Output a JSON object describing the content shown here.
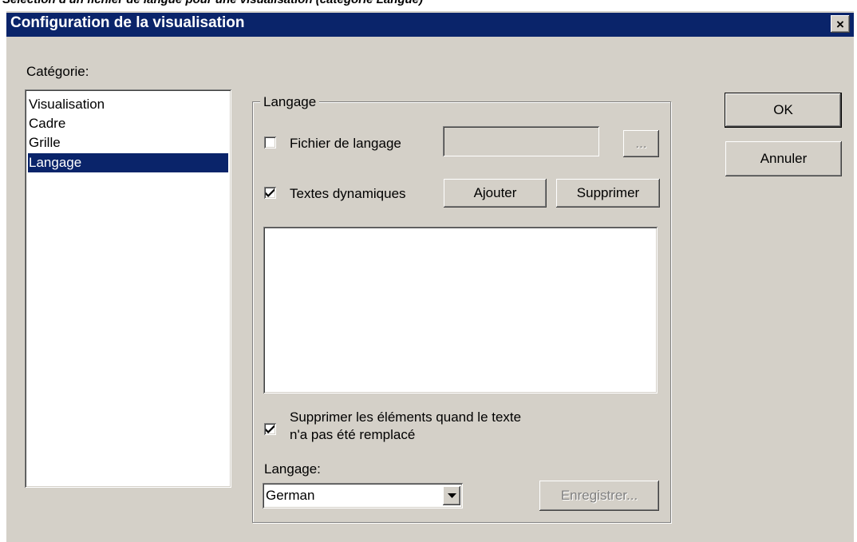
{
  "caption": "Sélection d'un fichier de langue pour une visualisation (catégorie Langue)",
  "window": {
    "title": "Configuration de la visualisation",
    "close_glyph": "×"
  },
  "category": {
    "label": "Catégorie:",
    "items": [
      "Visualisation",
      "Cadre",
      "Grille",
      "Langage"
    ],
    "selected": "Langage"
  },
  "language_group": {
    "title": "Langage",
    "language_file": {
      "label": "Fichier de langage",
      "checked": false,
      "value": "",
      "browse_label": "..."
    },
    "dynamic_texts": {
      "label": "Textes dynamiques",
      "checked": true,
      "add_label": "Ajouter",
      "remove_label": "Supprimer",
      "files": []
    },
    "suppress": {
      "label_line1": "Supprimer les éléments quand le texte",
      "label_line2": "n'a pas été remplacé",
      "checked": true
    },
    "language_label": "Langage:",
    "language_value": "German",
    "save_label": "Enregistrer..."
  },
  "buttons": {
    "ok_label": "OK",
    "cancel_label": "Annuler"
  }
}
